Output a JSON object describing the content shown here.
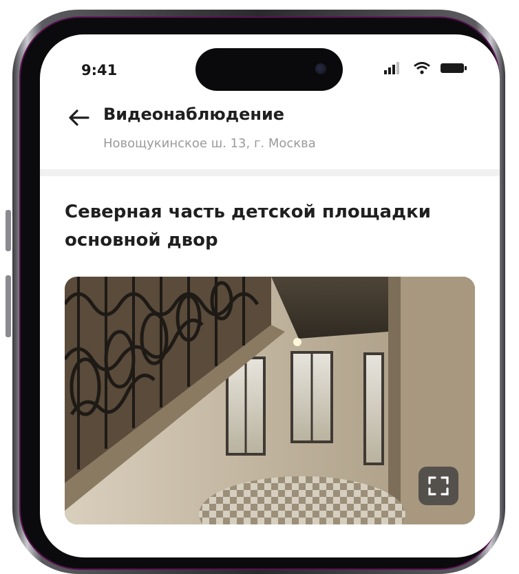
{
  "status_bar": {
    "time": "9:41",
    "icons": [
      "signal-icon",
      "wifi-icon",
      "battery-icon"
    ]
  },
  "header": {
    "back_icon": "arrow-left-icon",
    "title": "Видеонаблюдение",
    "subtitle": "Новощукинское ш. 13, г. Москва"
  },
  "camera": {
    "title": "Северная часть детской площадки основной двор",
    "fullscreen_icon": "fullscreen-icon"
  },
  "colors": {
    "text_primary": "#1f1f1f",
    "text_secondary": "#9a9a9a",
    "frame_accent": "#5a1050"
  }
}
